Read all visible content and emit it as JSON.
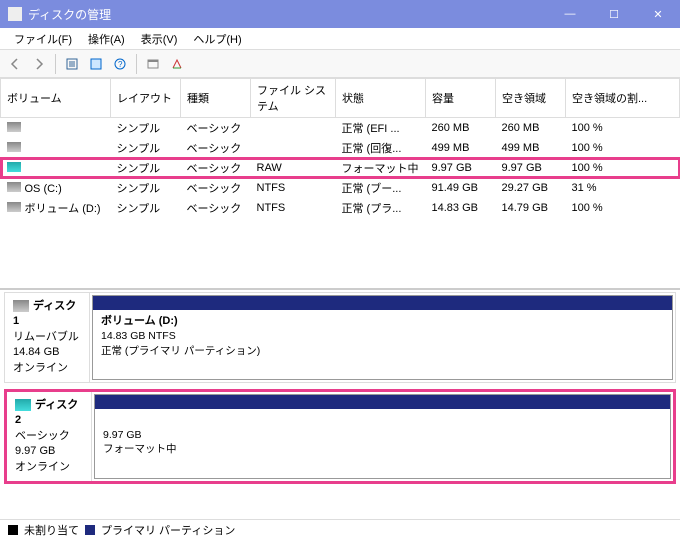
{
  "window": {
    "title": "ディスクの管理",
    "buttons": {
      "min": "―",
      "max": "☐",
      "close": "✕"
    }
  },
  "menu": {
    "file": "ファイル(F)",
    "actions": "操作(A)",
    "view": "表示(V)",
    "help": "ヘルプ(H)"
  },
  "columns": {
    "volume": "ボリューム",
    "layout": "レイアウト",
    "type": "種類",
    "filesystem": "ファイル システム",
    "status": "状態",
    "capacity": "容量",
    "free": "空き領域",
    "freepct": "空き領域の割..."
  },
  "rows": [
    {
      "icon": "gray",
      "name": "",
      "layout": "シンプル",
      "type": "ベーシック",
      "fs": "",
      "status": "正常 (EFI ...",
      "cap": "260 MB",
      "free": "260 MB",
      "pct": "100 %",
      "hl": false
    },
    {
      "icon": "gray",
      "name": "",
      "layout": "シンプル",
      "type": "ベーシック",
      "fs": "",
      "status": "正常 (回復...",
      "cap": "499 MB",
      "free": "499 MB",
      "pct": "100 %",
      "hl": false
    },
    {
      "icon": "teal",
      "name": "",
      "layout": "シンプル",
      "type": "ベーシック",
      "fs": "RAW",
      "status": "フォーマット中",
      "cap": "9.97 GB",
      "free": "9.97 GB",
      "pct": "100 %",
      "hl": true
    },
    {
      "icon": "gray",
      "name": "OS (C:)",
      "layout": "シンプル",
      "type": "ベーシック",
      "fs": "NTFS",
      "status": "正常 (ブー...",
      "cap": "91.49 GB",
      "free": "29.27 GB",
      "pct": "31 %",
      "hl": false
    },
    {
      "icon": "gray",
      "name": "ボリューム (D:)",
      "layout": "シンプル",
      "type": "ベーシック",
      "fs": "NTFS",
      "status": "正常 (プラ...",
      "cap": "14.83 GB",
      "free": "14.79 GB",
      "pct": "100 %",
      "hl": false
    }
  ],
  "disks": [
    {
      "icon": "gray",
      "name": "ディスク 1",
      "kind": "リムーバブル",
      "size": "14.84 GB",
      "status": "オンライン",
      "part_title": "ボリューム  (D:)",
      "part_line1": "14.83 GB NTFS",
      "part_line2": "正常 (プライマリ パーティション)",
      "hl": false
    },
    {
      "icon": "teal",
      "name": "ディスク 2",
      "kind": "ベーシック",
      "size": "9.97 GB",
      "status": "オンライン",
      "part_title": "",
      "part_line1": "9.97 GB",
      "part_line2": "フォーマット中",
      "hl": true
    }
  ],
  "legend": {
    "unalloc": "未割り当て",
    "primary": "プライマリ パーティション"
  }
}
